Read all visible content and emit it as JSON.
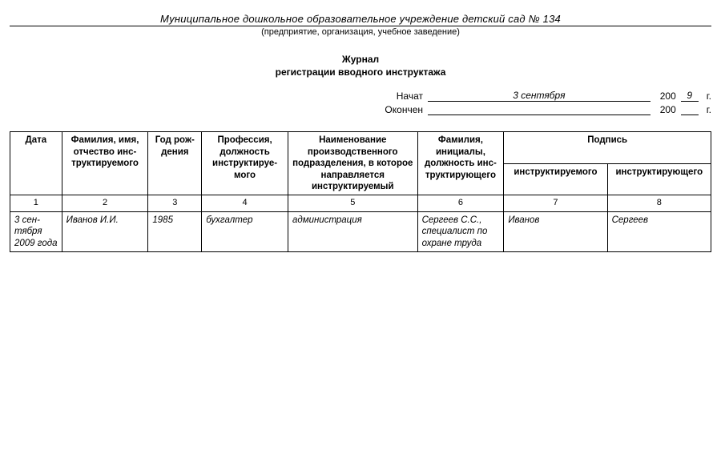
{
  "header": {
    "organization": "Муниципальное дошкольное образовательное учреждение детский сад № 134",
    "org_subtitle": "(предприятие, организация, учебное заведение)",
    "title_line1": "Журнал",
    "title_line2": "регистрации вводного инструктажа"
  },
  "dates": {
    "started_label": "Начат",
    "started_value": "3 сентября",
    "started_year_prefix": "200",
    "started_year_digit": "9",
    "started_year_suffix": "г.",
    "finished_label": "Окончен",
    "finished_value": "",
    "finished_year_prefix": "200",
    "finished_year_digit": "",
    "finished_year_suffix": "г."
  },
  "table": {
    "headers": {
      "date": "Дата",
      "fio": "Фамилия, имя, отчество инс-труктируемого",
      "year": "Год рож-дения",
      "profession": "Профессия, должность инструктируе-мого",
      "unit": "Наименование производственного подразделения, в которое направляется инструктируемый",
      "instructor": "Фамилия, инициалы, должность инс-труктирующего",
      "signature_group": "Подпись",
      "sig_trainee": "инструктируемого",
      "sig_instructor": "инструктирующего"
    },
    "col_numbers": [
      "1",
      "2",
      "3",
      "4",
      "5",
      "6",
      "7",
      "8"
    ],
    "rows": [
      {
        "date": "3 сен-тября 2009 года",
        "fio": "Иванов И.И.",
        "year": "1985",
        "profession": "бухгалтер",
        "unit": "администрация",
        "instructor": "Сергеев С.С., специалист по охране труда",
        "sig_trainee": "Иванов",
        "sig_instructor": "Сергеев"
      }
    ]
  }
}
